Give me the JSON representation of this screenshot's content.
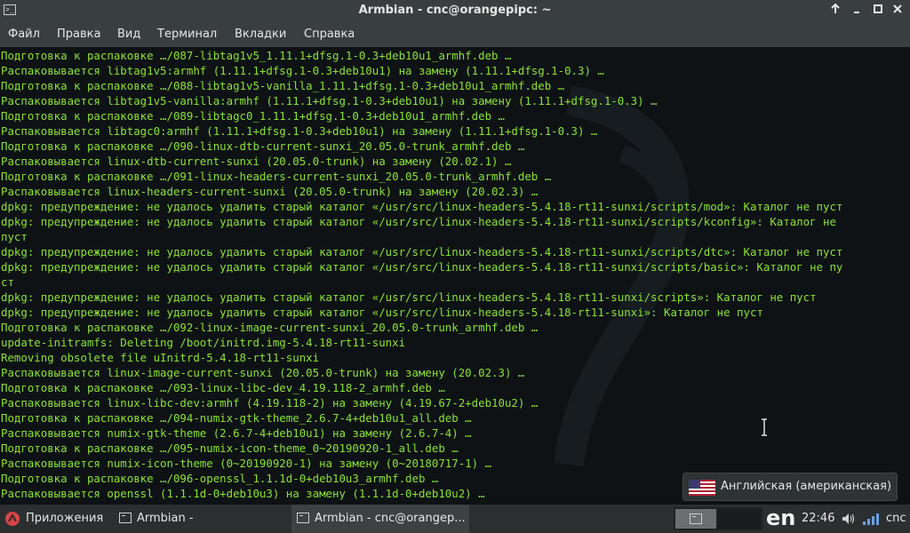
{
  "window": {
    "title": "Armbian - cnc@orangepipc: ~",
    "app_icon": "terminal-icon",
    "controls": [
      "up-arrow-icon",
      "minimize-icon",
      "maximize-icon",
      "close-icon"
    ]
  },
  "menu": {
    "items": [
      "Файл",
      "Правка",
      "Вид",
      "Терминал",
      "Вкладки",
      "Справка"
    ]
  },
  "terminal": {
    "text_color": "#8ae234",
    "background": "#0e1215",
    "lines": [
      "Подготовка к распаковке …/087-libtag1v5_1.11.1+dfsg.1-0.3+deb10u1_armhf.deb …",
      "Распаковывается libtag1v5:armhf (1.11.1+dfsg.1-0.3+deb10u1) на замену (1.11.1+dfsg.1-0.3) …",
      "Подготовка к распаковке …/088-libtag1v5-vanilla_1.11.1+dfsg.1-0.3+deb10u1_armhf.deb …",
      "Распаковывается libtag1v5-vanilla:armhf (1.11.1+dfsg.1-0.3+deb10u1) на замену (1.11.1+dfsg.1-0.3) …",
      "Подготовка к распаковке …/089-libtagc0_1.11.1+dfsg.1-0.3+deb10u1_armhf.deb …",
      "Распаковывается libtagc0:armhf (1.11.1+dfsg.1-0.3+deb10u1) на замену (1.11.1+dfsg.1-0.3) …",
      "Подготовка к распаковке …/090-linux-dtb-current-sunxi_20.05.0-trunk_armhf.deb …",
      "Распаковывается linux-dtb-current-sunxi (20.05.0-trunk) на замену (20.02.1) …",
      "Подготовка к распаковке …/091-linux-headers-current-sunxi_20.05.0-trunk_armhf.deb …",
      "Распаковывается linux-headers-current-sunxi (20.05.0-trunk) на замену (20.02.3) …",
      "dpkg: предупреждение: не удалось удалить старый каталог «/usr/src/linux-headers-5.4.18-rt11-sunxi/scripts/mod»: Каталог не пуст",
      "dpkg: предупреждение: не удалось удалить старый каталог «/usr/src/linux-headers-5.4.18-rt11-sunxi/scripts/kconfig»: Каталог не",
      "пуст",
      "dpkg: предупреждение: не удалось удалить старый каталог «/usr/src/linux-headers-5.4.18-rt11-sunxi/scripts/dtc»: Каталог не пуст",
      "dpkg: предупреждение: не удалось удалить старый каталог «/usr/src/linux-headers-5.4.18-rt11-sunxi/scripts/basic»: Каталог не пу",
      "ст",
      "dpkg: предупреждение: не удалось удалить старый каталог «/usr/src/linux-headers-5.4.18-rt11-sunxi/scripts»: Каталог не пуст",
      "dpkg: предупреждение: не удалось удалить старый каталог «/usr/src/linux-headers-5.4.18-rt11-sunxi»: Каталог не пуст",
      "Подготовка к распаковке …/092-linux-image-current-sunxi_20.05.0-trunk_armhf.deb …",
      "update-initramfs: Deleting /boot/initrd.img-5.4.18-rt11-sunxi",
      "Removing obsolete file uInitrd-5.4.18-rt11-sunxi",
      "Распаковывается linux-image-current-sunxi (20.05.0-trunk) на замену (20.02.3) …",
      "Подготовка к распаковке …/093-linux-libc-dev_4.19.118-2_armhf.deb …",
      "Распаковывается linux-libc-dev:armhf (4.19.118-2) на замену (4.19.67-2+deb10u2) …",
      "Подготовка к распаковке …/094-numix-gtk-theme_2.6.7-4+deb10u1_all.deb …",
      "Распаковывается numix-gtk-theme (2.6.7-4+deb10u1) на замену (2.6.7-4) …",
      "Подготовка к распаковке …/095-numix-icon-theme_0~20190920-1_all.deb …",
      "Распаковывается numix-icon-theme (0~20190920-1) на замену (0~20180717-1) …",
      "Подготовка к распаковке …/096-openssl_1.1.1d-0+deb10u3_armhf.deb …",
      "Распаковывается openssl (1.1.1d-0+deb10u3) на замену (1.1.1d-0+deb10u2) …"
    ]
  },
  "notification": {
    "icon": "us-flag-icon",
    "text": "Английская (американская)"
  },
  "taskbar": {
    "apps_menu": {
      "icon": "armbian-logo-icon",
      "label": "Приложения"
    },
    "tasks": [
      {
        "icon": "terminal-icon",
        "label": "Armbian -"
      },
      {
        "icon": "terminal-icon",
        "label": "Armbian - cnc@orangep..."
      }
    ],
    "keyboard_layout": "en",
    "clock": "22:46",
    "tray_icons": [
      "volume-icon",
      "network-signal-icon"
    ],
    "user": "cnc"
  }
}
